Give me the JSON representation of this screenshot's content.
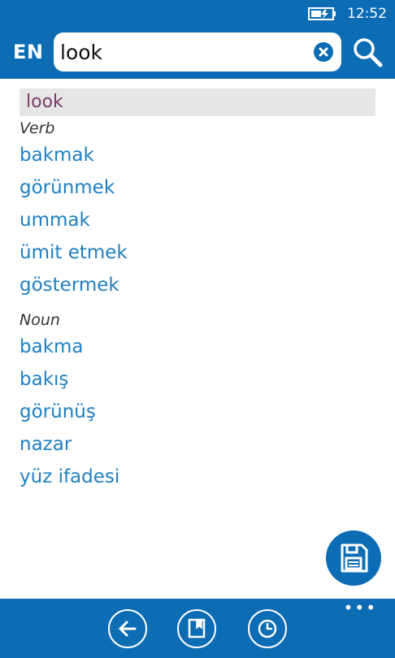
{
  "status": {
    "time": "12:52"
  },
  "header": {
    "lang": "EN"
  },
  "search": {
    "value": "look"
  },
  "entry": {
    "headword": "look",
    "groups": [
      {
        "pos": "Verb",
        "translations": [
          "bakmak",
          "görünmek",
          "ummak",
          "ümit etmek",
          "göstermek"
        ]
      },
      {
        "pos": "Noun",
        "translations": [
          "bakma",
          "bakış",
          "görünüş",
          "nazar",
          "yüz ifadesi"
        ]
      }
    ]
  },
  "appbar": {
    "more": "•••"
  },
  "colors": {
    "accent": "#0c6cb4",
    "link": "#1f7fc2",
    "headword": "#7a3b66"
  },
  "icons": {
    "battery": "battery-charging-icon",
    "clear": "clear-icon",
    "search": "search-icon",
    "save": "save-icon",
    "back": "back-icon",
    "bookmark": "bookmark-icon",
    "history": "history-icon"
  }
}
